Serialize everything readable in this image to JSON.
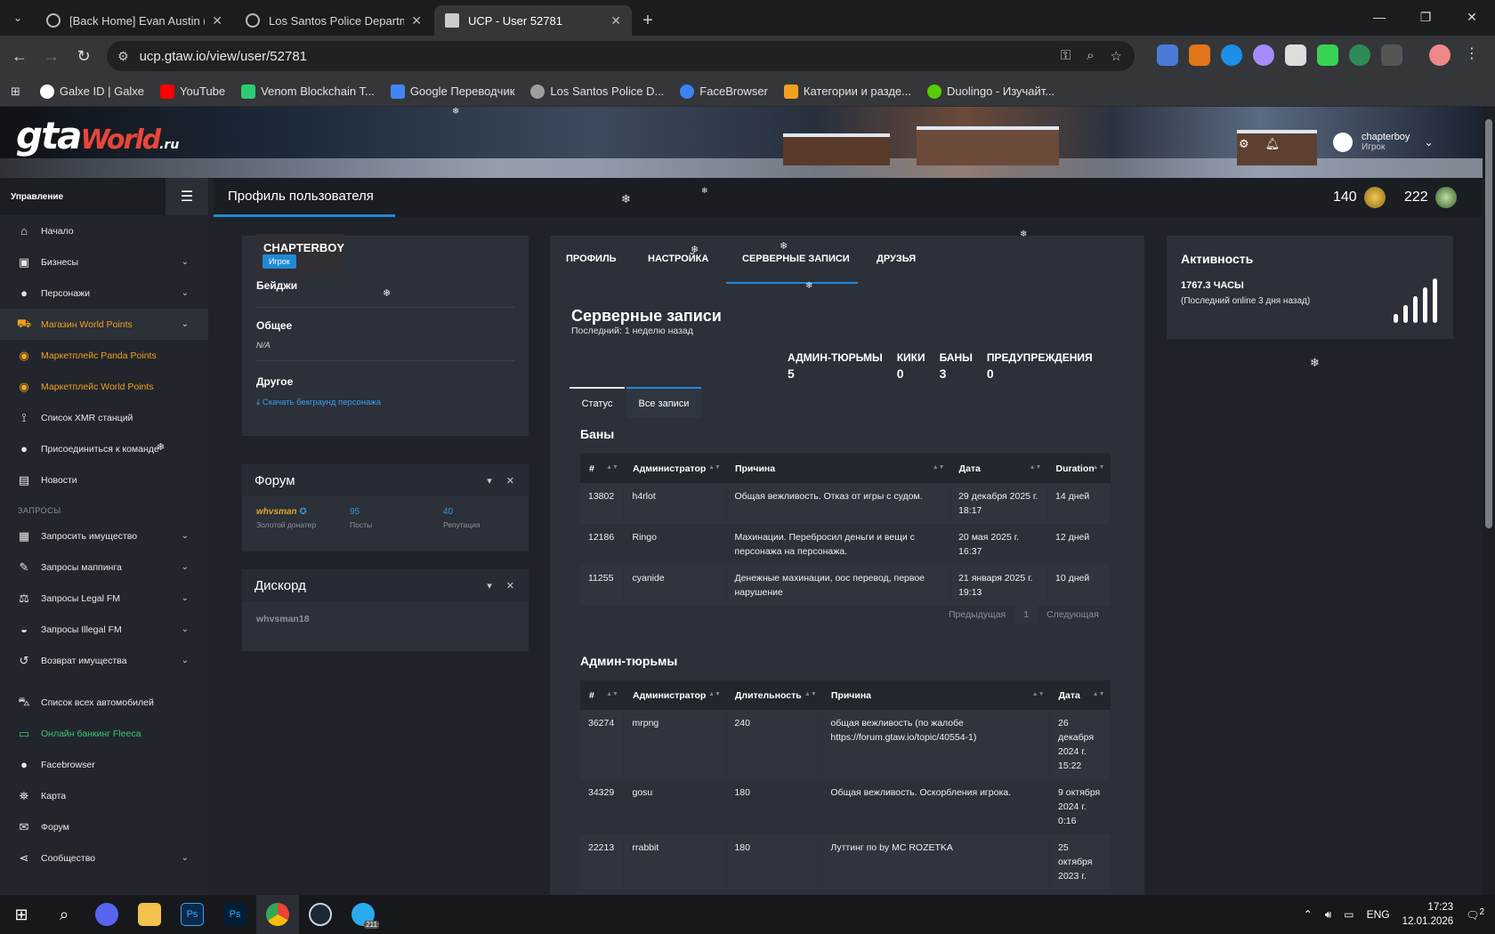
{
  "browser": {
    "tabs": [
      {
        "label": "[Back Home] Evan Austin (whvsman",
        "active": false
      },
      {
        "label": "Los Santos Police Department -",
        "active": false
      },
      {
        "label": "UCP - User 52781",
        "active": true
      }
    ],
    "url": "ucp.gtaw.io/view/user/52781",
    "bookmarks": [
      {
        "label": "Galxe ID | Galxe",
        "color": "#ffffff"
      },
      {
        "label": "YouTube",
        "color": "#ff0000"
      },
      {
        "label": "Venom Blockchain T...",
        "color": "#2ecc71"
      },
      {
        "label": "Google Переводчик",
        "color": "#4285f4"
      },
      {
        "label": "Los Santos Police D...",
        "color": "#9e9e9e"
      },
      {
        "label": "FaceBrowser",
        "color": "#3b82f6"
      },
      {
        "label": "Категории и разде...",
        "color": "#f0a020"
      },
      {
        "label": "Duolingo - Изучайт...",
        "color": "#58cc02"
      }
    ]
  },
  "header": {
    "logo_main": "gta",
    "logo_world": "World",
    "logo_ru": ".ru",
    "user_name": "chapterboy",
    "user_role": "Игрок"
  },
  "sidebar": {
    "title": "Управление",
    "items": [
      {
        "label": "Начало",
        "icon": "home-icon",
        "glyph": "⌂",
        "style": "",
        "chevron": false
      },
      {
        "label": "Бизнесы",
        "icon": "briefcase-icon",
        "glyph": "▣",
        "style": "",
        "chevron": true
      },
      {
        "label": "Персонажи",
        "icon": "user-icon",
        "glyph": "●",
        "style": "",
        "chevron": true
      },
      {
        "label": "Магазин World Points",
        "icon": "cart-icon",
        "glyph": "⛟",
        "style": "orange active",
        "chevron": true
      },
      {
        "label": "Маркетплейс Panda Points",
        "icon": "coins-icon",
        "glyph": "◉",
        "style": "orange",
        "chevron": false
      },
      {
        "label": "Маркетплейс World Points",
        "icon": "coins-icon",
        "glyph": "◉",
        "style": "orange",
        "chevron": false
      },
      {
        "label": "Список XMR станций",
        "icon": "antenna-icon",
        "glyph": "⟟",
        "style": "",
        "chevron": false
      },
      {
        "label": "Присоединиться к команде",
        "icon": "user-plus-icon",
        "glyph": "●",
        "style": "",
        "chevron": false
      },
      {
        "label": "Новости",
        "icon": "newspaper-icon",
        "glyph": "▤",
        "style": "",
        "chevron": false
      }
    ],
    "section_requests": "ЗАПРОСЫ",
    "items2": [
      {
        "label": "Запросить имущество",
        "icon": "building-icon",
        "glyph": "▦",
        "style": "",
        "chevron": true
      },
      {
        "label": "Запросы маппинга",
        "icon": "brush-icon",
        "glyph": "✎",
        "style": "",
        "chevron": true
      },
      {
        "label": "Запросы Legal FM",
        "icon": "scale-icon",
        "glyph": "⚖",
        "style": "",
        "chevron": true
      },
      {
        "label": "Запросы Illegal FM",
        "icon": "mask-icon",
        "glyph": "◒",
        "style": "",
        "chevron": true
      },
      {
        "label": "Возврат имущества",
        "icon": "undo-icon",
        "glyph": "↺",
        "style": "",
        "chevron": true
      }
    ],
    "items3": [
      {
        "label": "Список всех автомобилей",
        "icon": "car-icon",
        "glyph": "⛍",
        "style": "",
        "chevron": false
      },
      {
        "label": "Онлайн банкинг Fleeca",
        "icon": "money-icon",
        "glyph": "▭",
        "style": "green",
        "chevron": false
      },
      {
        "label": "Facebrowser",
        "icon": "users-icon",
        "glyph": "●",
        "style": "",
        "chevron": false
      },
      {
        "label": "Карта",
        "icon": "map-icon",
        "glyph": "⛯",
        "style": "",
        "chevron": false
      },
      {
        "label": "Форум",
        "icon": "comments-icon",
        "glyph": "✉",
        "style": "",
        "chevron": false
      },
      {
        "label": "Сообщество",
        "icon": "share-icon",
        "glyph": "⋖",
        "style": "",
        "chevron": true
      }
    ]
  },
  "page": {
    "title": "Профиль пользователя",
    "points_1": "140",
    "points_2": "222"
  },
  "profile": {
    "name": "CHAPTERBOY",
    "role": "Игрок",
    "badges_label": "Бейджи",
    "general_label": "Общее",
    "general_value": "N/A",
    "other_label": "Другое",
    "download_link": "Скачать бекграунд персонажа"
  },
  "forum": {
    "title": "Форум",
    "username": "whvsman",
    "username_sub": "Золотой донатер",
    "posts": "95",
    "posts_label": "Посты",
    "reputation": "40",
    "reputation_label": "Репутация"
  },
  "discord": {
    "title": "Дискорд",
    "value": "whvsman18"
  },
  "center": {
    "tabs": [
      "ПРОФИЛЬ",
      "НАСТРОЙКА",
      "СЕРВЕРНЫЕ ЗАПИСИ",
      "ДРУЗЬЯ"
    ],
    "title": "Серверные записи",
    "subtitle": "Последний: 1 неделю назад",
    "counters": [
      {
        "label": "АДМИН-ТЮРЬМЫ",
        "value": "5"
      },
      {
        "label": "КИКИ",
        "value": "0"
      },
      {
        "label": "БАНЫ",
        "value": "3"
      },
      {
        "label": "ПРЕДУПРЕЖДЕНИЯ",
        "value": "0"
      }
    ],
    "subtabs": [
      "Статус",
      "Все записи"
    ]
  },
  "bans": {
    "title": "Баны",
    "headers": [
      "#",
      "Администратор",
      "Причина",
      "Дата",
      "Duration"
    ],
    "rows": [
      [
        "13802",
        "h4rlot",
        "Общая вежливость. Отказ от игры с судом.",
        "29 декабря 2025 г. 18:17",
        "14 дней"
      ],
      [
        "12186",
        "Ringo",
        "Махинации. Перебросил деньги и вещи с персонажа на персонажа.",
        "20 мая 2025 г. 16:37",
        "12 дней"
      ],
      [
        "11255",
        "cyanide",
        "Денежные махинации, оос перевод, первое нарушение",
        "21 января 2025 г. 19:13",
        "10 дней"
      ]
    ],
    "pager": {
      "prev": "Предыдущая",
      "page": "1",
      "next": "Следующая"
    }
  },
  "jails": {
    "title": "Админ-тюрьмы",
    "headers": [
      "#",
      "Администратор",
      "Длительность",
      "Причина",
      "Дата"
    ],
    "rows": [
      [
        "36274",
        "mrpng",
        "240",
        "общая вежливость (по жалобе https://forum.gtaw.io/topic/40554-1)",
        "26 декабря 2024 г. 15:22"
      ],
      [
        "34329",
        "gosu",
        "180",
        "Общая вежливость. Оскорбления игрока.",
        "9 октября 2024 г. 0:16"
      ],
      [
        "22213",
        "rrabbit",
        "180",
        "Луттинг по by MC ROZETKA",
        "25 октября 2023 г."
      ]
    ]
  },
  "activity": {
    "title": "Активность",
    "hours": "1767.3 ЧАСЫ",
    "last_online": "(Последний online 3 дня назад)"
  },
  "taskbar": {
    "lang": "ENG",
    "time": "17:23",
    "date": "12.01.2026",
    "badge": "211",
    "notif": "2"
  }
}
